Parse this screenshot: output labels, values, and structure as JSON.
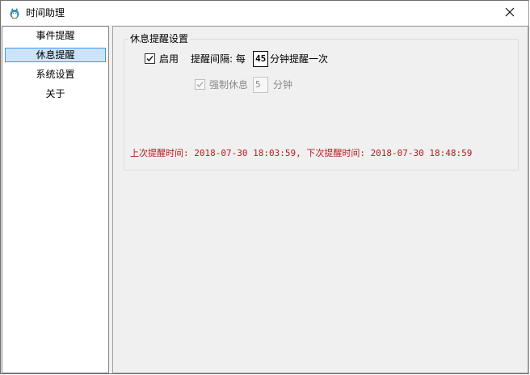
{
  "window": {
    "title": "时间助理"
  },
  "sidebar": {
    "items": [
      {
        "label": "事件提醒"
      },
      {
        "label": "休息提醒"
      },
      {
        "label": "系统设置"
      },
      {
        "label": "关于"
      }
    ],
    "selected_index": 1
  },
  "rest_reminder": {
    "group_title": "休息提醒设置",
    "enable": {
      "label": "启用",
      "checked": true
    },
    "interval": {
      "prefix": "提醒间隔: 每",
      "value": "45",
      "suffix": "分钟提醒一次"
    },
    "force_rest": {
      "label": "强制休息",
      "checked": true,
      "enabled": false,
      "value": "5",
      "unit": "分钟"
    },
    "status_line": "上次提醒时间: 2018-07-30 18:03:59, 下次提醒时间: 2018-07-30 18:48:59"
  },
  "colors": {
    "status_text": "#b31b1b",
    "selection_fill": "#cce4f7",
    "selection_border": "#3399ff"
  },
  "icons": {
    "app": "mascot-icon",
    "close": "close-icon",
    "check": "checkmark-icon"
  }
}
